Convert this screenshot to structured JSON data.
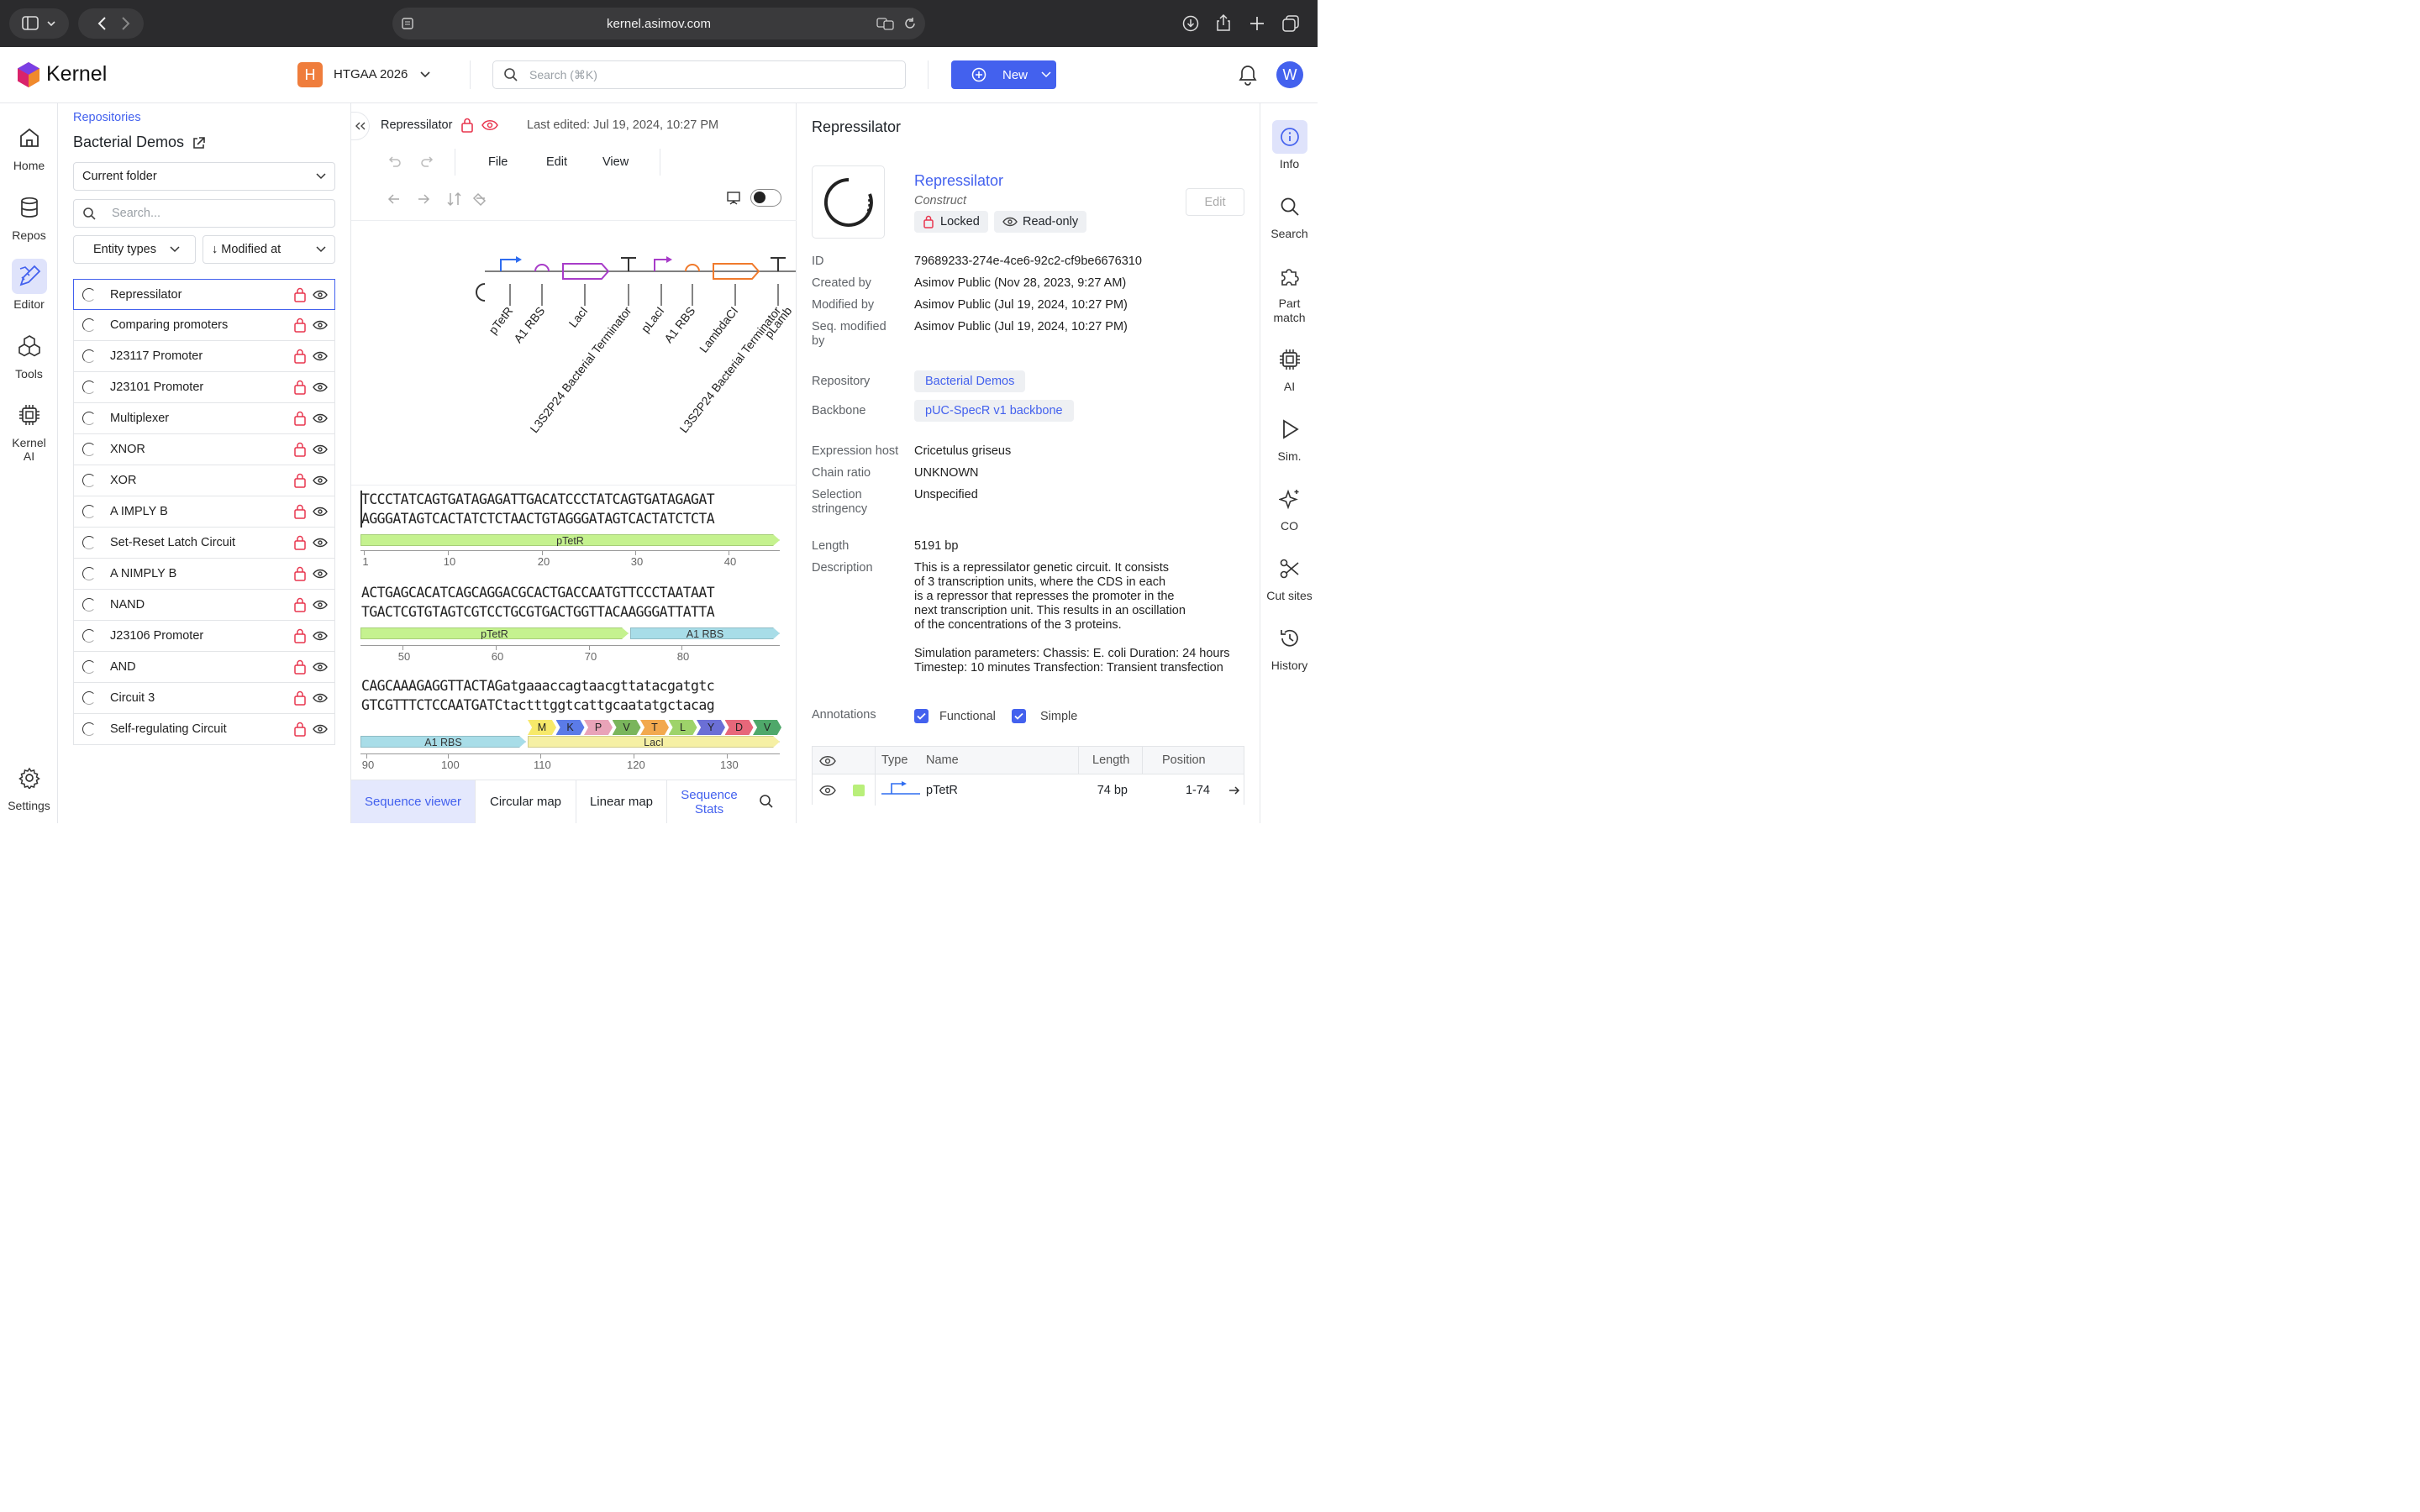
{
  "browser": {
    "url": "kernel.asimov.com"
  },
  "header": {
    "brand": "Kernel",
    "workspace_initial": "H",
    "workspace_name": "HTGAA 2026",
    "search_placeholder": "Search (⌘K)",
    "new_label": "New",
    "avatar_initial": "W"
  },
  "left_nav": {
    "items": [
      {
        "label": "Home",
        "icon": "home-icon"
      },
      {
        "label": "Repos",
        "icon": "database-icon"
      },
      {
        "label": "Editor",
        "icon": "editor-icon"
      },
      {
        "label": "Tools",
        "icon": "tools-icon"
      },
      {
        "label": "Kernel",
        "label2": "AI",
        "icon": "chip-icon"
      }
    ],
    "settings": "Settings",
    "active": "Editor"
  },
  "repo_panel": {
    "breadcrumb": "Repositories",
    "title": "Bacterial Demos",
    "folder_select": "Current folder",
    "search_placeholder": "Search...",
    "entity_filter": "Entity types",
    "sort": "↓ Modified at",
    "files": [
      "Repressilator",
      "Comparing promoters",
      "J23117 Promoter",
      "J23101 Promoter",
      "Multiplexer",
      "XNOR",
      "XOR",
      "A IMPLY B",
      "Set-Reset Latch Circuit",
      "A NIMPLY B",
      "NAND",
      "J23106 Promoter",
      "AND",
      "Circuit 3",
      "Self-regulating Circuit"
    ]
  },
  "editor": {
    "doc_title": "Repressilator",
    "last_edited": "Last edited: Jul 19, 2024, 10:27 PM",
    "menus": [
      "File",
      "Edit",
      "View"
    ],
    "map_labels": [
      "pTetR",
      "A1 RBS",
      "LacI",
      "L3S2P24 Bacterial Terminator",
      "pLacI",
      "A1 RBS",
      "LambdaCI",
      "L3S2P24 Bacterial Terminator",
      "pLamb"
    ],
    "blocks": [
      {
        "top": "TCCCTATCAGTGATAGAGATTGACATCCCTATCAGTGATAGAGAT",
        "bottom": "AGGGATAGTCACTATCTCTAACTGTAGGGATAGTCACTATCTCTA",
        "features": [
          {
            "name": "pTetR",
            "color": "#c5f28f"
          }
        ],
        "ticks": [
          "1",
          "10",
          "20",
          "30",
          "40"
        ]
      },
      {
        "top": "ACTGAGCACATCAGCAGGACGCACTGACCAATGTTCCCTAATAAT",
        "bottom": "TGACTCGTGTAGTCGTCCTGCGTGACTGGTTACAAGGGATTATTA",
        "features": [
          {
            "name": "pTetR",
            "color": "#c5f28f"
          },
          {
            "name": "A1 RBS",
            "color": "#a8dde8"
          }
        ],
        "ticks": [
          "50",
          "60",
          "70",
          "80"
        ]
      },
      {
        "top": "CAGCAAAGAGGTTACTAGatgaaaccagtaacgttatacgatgtc",
        "bottom": "GTCGTTTCTCCAATGATCtactttggtcattgcaatatgctacag",
        "features": [
          {
            "name": "A1 RBS",
            "color": "#a8dde8"
          },
          {
            "name": "LacI",
            "color": "#f6f0a4"
          }
        ],
        "aminoacids": [
          "M",
          "K",
          "P",
          "V",
          "T",
          "L",
          "Y",
          "D",
          "V"
        ],
        "ticks": [
          "90",
          "100",
          "110",
          "120",
          "130"
        ]
      }
    ],
    "tabs": [
      "Sequence viewer",
      "Circular map",
      "Linear map",
      "Sequence",
      "Stats"
    ]
  },
  "info": {
    "panel_title": "Repressilator",
    "name": "Repressilator",
    "kind": "Construct",
    "locked": "Locked",
    "readonly": "Read-only",
    "edit": "Edit",
    "fields": {
      "id_label": "ID",
      "id": "79689233-274e-4ce6-92c2-cf9be6676310",
      "created_label": "Created by",
      "created": "Asimov Public (Nov 28, 2023, 9:27 AM)",
      "modified_label": "Modified by",
      "modified": "Asimov Public (Jul 19, 2024, 10:27 PM)",
      "seqmod_label1": "Seq. modified",
      "seqmod_label2": "by",
      "seqmod": "Asimov Public (Jul 19, 2024, 10:27 PM)",
      "repo_label": "Repository",
      "repo": "Bacterial Demos",
      "backbone_label": "Backbone",
      "backbone": "pUC-SpecR v1 backbone",
      "host_label": "Expression host",
      "host": "Cricetulus griseus",
      "chain_label": "Chain ratio",
      "chain": "UNKNOWN",
      "strin_label1": "Selection",
      "strin_label2": "stringency",
      "strin": "Unspecified",
      "length_label": "Length",
      "length": "5191 bp",
      "desc_label": "Description",
      "desc_lines": [
        "This is a repressilator genetic circuit. It consists",
        "of 3 transcription units, where the CDS in each",
        "is a repressor that represses the promoter in the",
        "next transcription unit. This results in an oscillation",
        "of the concentrations of the 3 proteins.",
        "",
        "Simulation parameters: Chassis: E. coli Duration: 24 hours",
        "Timestep: 10 minutes Transfection: Transient transfection"
      ],
      "annot_label": "Annotations",
      "functional": "Functional",
      "simple": "Simple"
    },
    "table": {
      "headers": [
        "Type",
        "Name",
        "Length",
        "Position"
      ],
      "row": {
        "name": "pTetR",
        "length": "74 bp",
        "position": "1-74",
        "color": "#b9ef7a"
      }
    }
  },
  "right_rail": {
    "items": [
      {
        "label": "Info"
      },
      {
        "label": "Search"
      },
      {
        "label": "Part",
        "label2": "match"
      },
      {
        "label": "AI"
      },
      {
        "label": "Sim."
      },
      {
        "label": "CO"
      },
      {
        "label": "Cut sites"
      },
      {
        "label": "History"
      }
    ]
  }
}
